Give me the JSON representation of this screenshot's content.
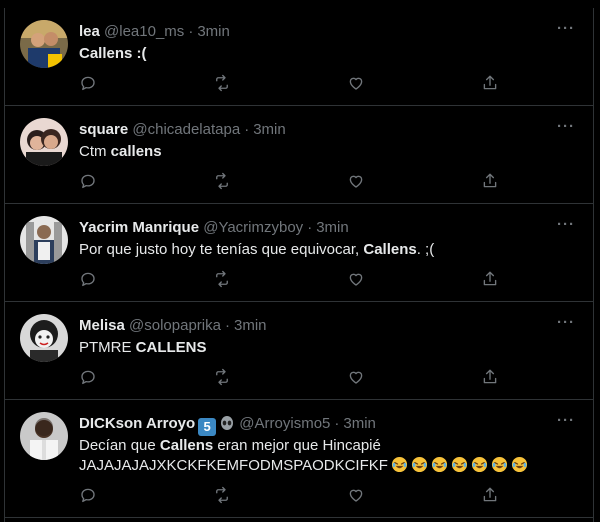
{
  "tweets": [
    {
      "name": "lea",
      "handle": "@lea10_ms",
      "time": "3min",
      "text_parts": [
        {
          "t": "Callens :(",
          "bold": true
        }
      ]
    },
    {
      "name": "square",
      "handle": "@chicadelatapa",
      "time": "3min",
      "text_parts": [
        {
          "t": "Ctm ",
          "bold": false
        },
        {
          "t": "callens",
          "bold": true
        }
      ]
    },
    {
      "name": "Yacrim Manrique",
      "handle": "@Yacrimzyboy",
      "time": "3min",
      "text_parts": [
        {
          "t": "Por que justo hoy te tenías que equivocar, ",
          "bold": false
        },
        {
          "t": "Callens",
          "bold": true
        },
        {
          "t": ". ;(",
          "bold": false
        }
      ]
    },
    {
      "name": "Melisa",
      "handle": "@solopaprika",
      "time": "3min",
      "text_parts": [
        {
          "t": "PTMRE ",
          "bold": false
        },
        {
          "t": "CALLENS",
          "bold": true
        }
      ]
    },
    {
      "name": "DICKson Arroyo",
      "verified_badge": "5",
      "handle": "@Arroyismo5",
      "time": "3min",
      "text_parts": [
        {
          "t": "Decían que ",
          "bold": false
        },
        {
          "t": "Callens",
          "bold": true
        },
        {
          "t": " eran mejor que Hincapié",
          "bold": false
        }
      ],
      "text_line2": "JAJAJAJAJXKCKFKEMFODMSPAODKCIFKF",
      "emoji": "rolling-on-floor-laughing",
      "emoji_count": 7
    }
  ],
  "colors": {
    "background": "#000000",
    "border": "#2f3336",
    "text": "#e7e9ea",
    "muted": "#71767b",
    "badge": "#3b88c3"
  },
  "icons": [
    "reply-icon",
    "retweet-icon",
    "like-icon",
    "share-icon",
    "more-icon"
  ]
}
